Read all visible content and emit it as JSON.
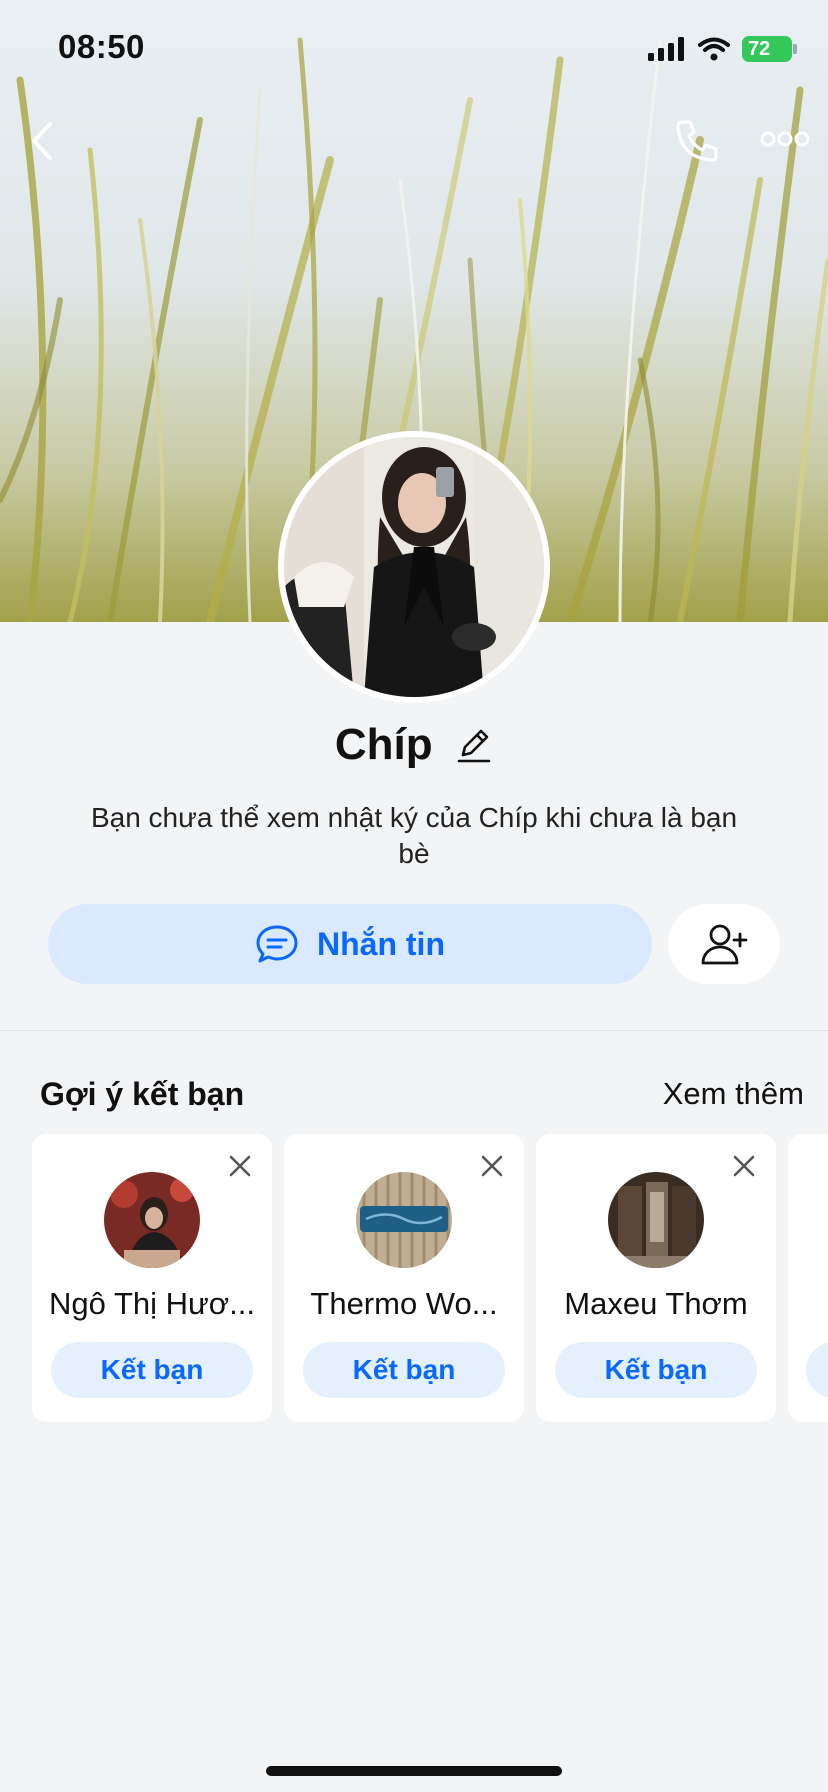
{
  "status_bar": {
    "time": "08:50",
    "battery": "72"
  },
  "header": {
    "back_icon": "chevron-left-icon",
    "call_icon": "phone-icon",
    "more_icon": "more-horizontal-icon"
  },
  "profile": {
    "name": "Chíp",
    "notice": "Bạn chưa thể xem nhật ký của Chíp khi chưa là bạn bè",
    "message_button": "Nhắn tin"
  },
  "suggestions": {
    "title": "Gợi ý kết bạn",
    "see_more": "Xem thêm",
    "items": [
      {
        "name": "Ngô Thị Hươ...",
        "button": "Kết bạn"
      },
      {
        "name": "Thermo Wo...",
        "button": "Kết bạn"
      },
      {
        "name": "Maxeu Thơm",
        "button": "Kết bạn"
      }
    ]
  },
  "colors": {
    "accent": "#0a68ff",
    "accent_soft": "#dae9fd",
    "battery": "#34c759",
    "background": "#f3f4f6"
  }
}
